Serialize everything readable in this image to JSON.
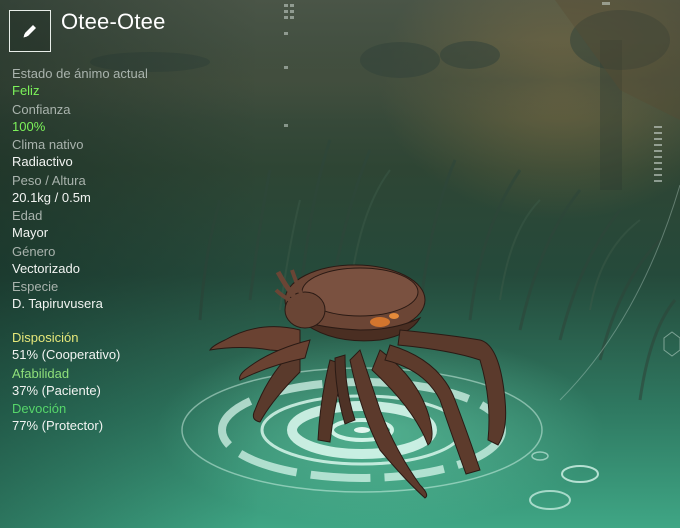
{
  "creature": {
    "name": "Otee-Otee"
  },
  "stats": [
    {
      "label": "Estado de ánimo actual",
      "value": "Feliz",
      "highlight": true
    },
    {
      "label": "Confianza",
      "value": "100%",
      "highlight": true
    },
    {
      "label": "Clima nativo",
      "value": "Radiactivo",
      "highlight": false
    },
    {
      "label": "Peso / Altura",
      "value": "20.1kg / 0.5m",
      "highlight": false
    },
    {
      "label": "Edad",
      "value": "Mayor",
      "highlight": false
    },
    {
      "label": "Género",
      "value": "Vectorizado",
      "highlight": false
    },
    {
      "label": "Especie",
      "value": "D. Tapiruvusera",
      "highlight": false
    }
  ],
  "traits": [
    {
      "label": "Disposición",
      "value": "51% (Cooperativo)",
      "color": "#e6e87a"
    },
    {
      "label": "Afabilidad",
      "value": "37% (Paciente)",
      "color": "#8fe07a"
    },
    {
      "label": "Devoción",
      "value": "77% (Protector)",
      "color": "#56d66a"
    }
  ],
  "icons": {
    "edit": "pencil-icon"
  }
}
